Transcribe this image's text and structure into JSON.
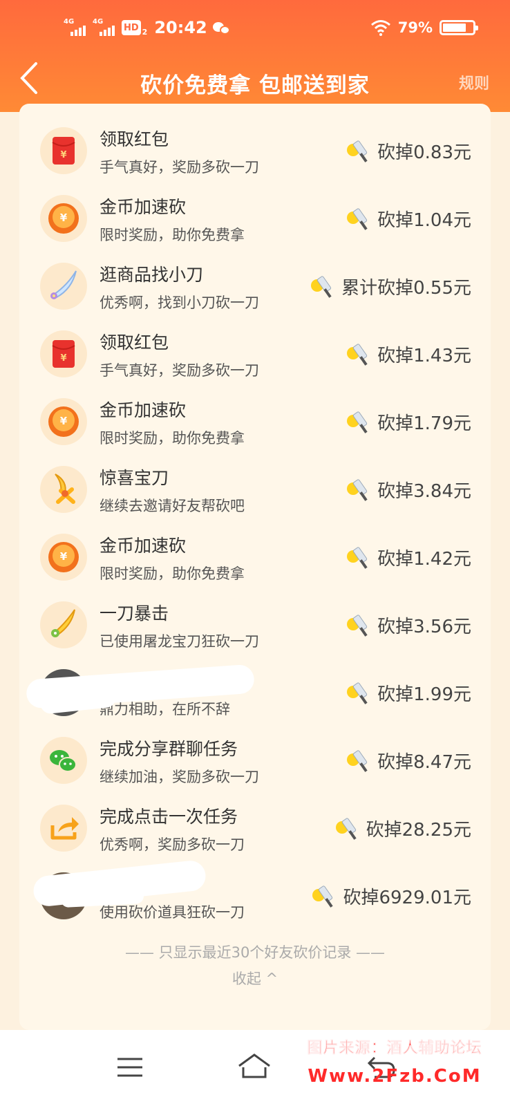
{
  "status": {
    "net1": "4G",
    "net2": "4G",
    "hd": "HD",
    "hd_sub": "2",
    "time": "20:42",
    "battery": "79%"
  },
  "header": {
    "title": "砍价免费拿 包邮送到家",
    "rules": "规则"
  },
  "records": [
    {
      "icon": "red-envelope-icon",
      "title": "领取红包",
      "subtitle": "手气真好，奖励多砍一刀",
      "amount": "砍掉0.83元"
    },
    {
      "icon": "gold-coin-icon",
      "title": "金币加速砍",
      "subtitle": "限时奖励，助你免费拿",
      "amount": "砍掉1.04元"
    },
    {
      "icon": "small-knife-icon",
      "title": "逛商品找小刀",
      "subtitle": "优秀啊，找到小刀砍一刀",
      "amount": "累计砍掉0.55元"
    },
    {
      "icon": "red-envelope-icon",
      "title": "领取红包",
      "subtitle": "手气真好，奖励多砍一刀",
      "amount": "砍掉1.43元"
    },
    {
      "icon": "gold-coin-icon",
      "title": "金币加速砍",
      "subtitle": "限时奖励，助你免费拿",
      "amount": "砍掉1.79元"
    },
    {
      "icon": "surprise-blade-icon",
      "title": "惊喜宝刀",
      "subtitle": "继续去邀请好友帮砍吧",
      "amount": "砍掉3.84元"
    },
    {
      "icon": "gold-coin-icon",
      "title": "金币加速砍",
      "subtitle": "限时奖励，助你免费拿",
      "amount": "砍掉1.42元"
    },
    {
      "icon": "dragon-blade-icon",
      "title": "一刀暴击",
      "subtitle": "已使用屠龙宝刀狂砍一刀",
      "amount": "砍掉3.56元"
    },
    {
      "icon": "friend-avatar",
      "title": "",
      "subtitle": "鼎力相助，在所不辞",
      "amount": "砍掉1.99元"
    },
    {
      "icon": "wechat-icon",
      "title": "完成分享群聊任务",
      "subtitle": "继续加油，奖励多砍一刀",
      "amount": "砍掉8.47元"
    },
    {
      "icon": "share-arrow-icon",
      "title": "完成点击一次任务",
      "subtitle": "优秀啊，奖励多砍一刀",
      "amount": "砍掉28.25元"
    },
    {
      "icon": "friend-avatar",
      "title": "",
      "subtitle": "使用砍价道具狂砍一刀",
      "amount": "砍掉6929.01元"
    }
  ],
  "footer": {
    "note": "—— 只显示最近30个好友砍价记录 ——",
    "collapse": "收起 ^"
  },
  "watermark": {
    "line1": "图片来源：酒人辅助论坛",
    "line2": "Www.2Fzb.CoM"
  },
  "colors": {
    "header_top": "#ff6a3d",
    "header_bottom": "#ff8a35",
    "card_bg": "#fff7e9",
    "page_bg": "#fdf1df",
    "watermark": "#ff2a2a"
  }
}
